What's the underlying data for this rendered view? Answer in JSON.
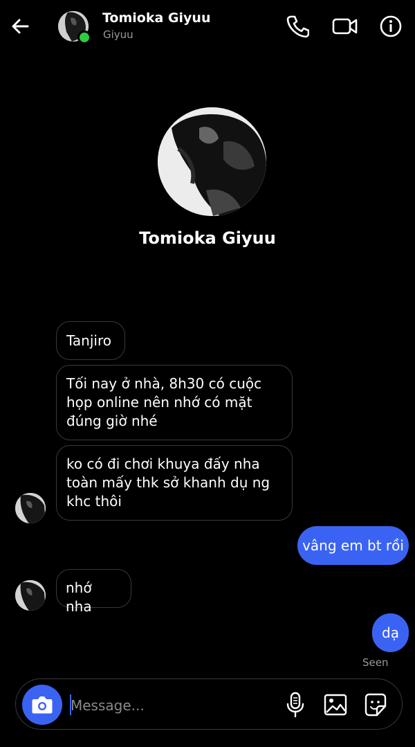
{
  "header": {
    "name": "Tomioka Giyuu",
    "username": "Giyuu",
    "icons": [
      "back-arrow-icon",
      "phone-icon",
      "video-camera-icon",
      "info-icon"
    ]
  },
  "profile": {
    "name": "Tomioka Giyuu"
  },
  "messages": [
    {
      "from": "them",
      "text": "Tanjiro"
    },
    {
      "from": "them",
      "lines": [
        "Tối nay ở nhà, 8h30  có cuộc",
        "họp online nên nhớ có mặt",
        "đúng giờ nhé"
      ]
    },
    {
      "from": "them",
      "lines": [
        "ko có đi chơi khuya đấy nha",
        "toàn mấy thk sở khanh dụ ng",
        "khc thôi"
      ]
    },
    {
      "from": "me",
      "text": "vâng em bt rồi"
    },
    {
      "from": "them",
      "text": "nhớ nha"
    },
    {
      "from": "me",
      "text": "dạ"
    }
  ],
  "status": {
    "seen": "Seen"
  },
  "composer": {
    "placeholder": "Message...",
    "icons": [
      "camera-icon",
      "microphone-icon",
      "image-icon",
      "sticker-icon"
    ]
  },
  "colors": {
    "background": "#000000",
    "accent": "#3b63f3",
    "online": "#2ecc40",
    "bubble_border": "#3a3a3a",
    "muted_text": "#9a9a9a"
  }
}
